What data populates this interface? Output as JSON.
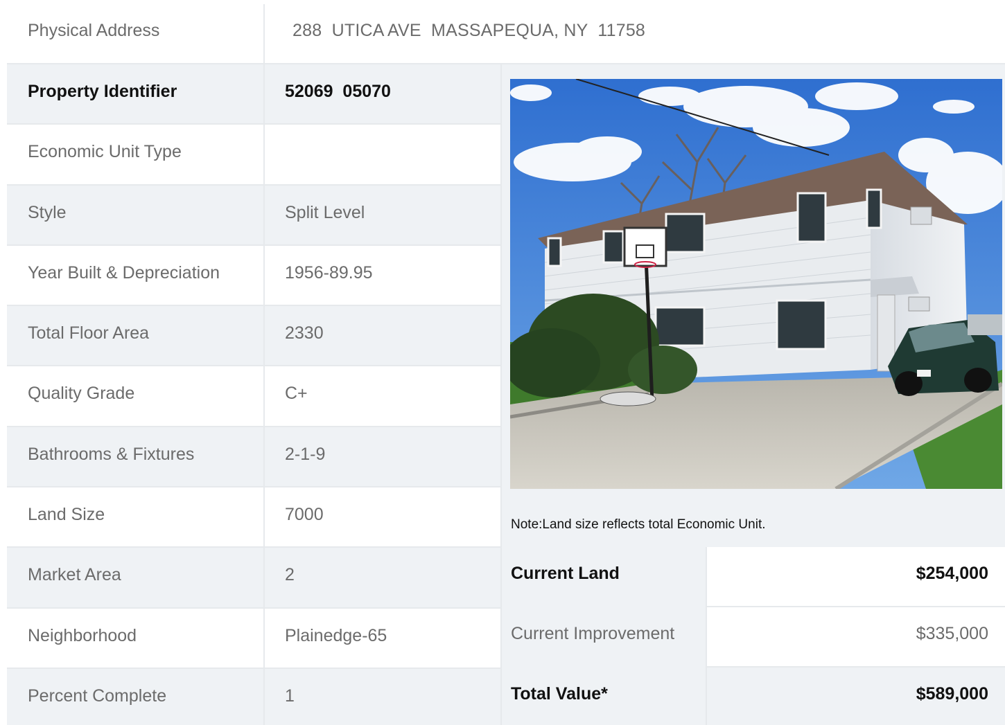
{
  "address": {
    "label": "Physical Address",
    "value": "288  UTICA AVE  MASSAPEQUA, NY  11758"
  },
  "details": [
    {
      "label": "Property Identifier",
      "value": "52069  05070"
    },
    {
      "label": "Economic Unit Type",
      "value": ""
    },
    {
      "label": "Style",
      "value": "Split Level"
    },
    {
      "label": "Year Built & Depreciation",
      "value": "1956-89.95"
    },
    {
      "label": "Total Floor Area",
      "value": "2330"
    },
    {
      "label": "Quality Grade",
      "value": "C+"
    },
    {
      "label": "Bathrooms & Fixtures",
      "value": "2-1-9"
    },
    {
      "label": "Land Size",
      "value": "7000"
    },
    {
      "label": "Market Area",
      "value": "2"
    },
    {
      "label": "Neighborhood",
      "value": "Plainedge-65"
    },
    {
      "label": "Percent Complete",
      "value": "1"
    }
  ],
  "photo": {
    "icon": "house-photo"
  },
  "note": "Note:Land size reflects total Economic Unit.",
  "valuation": [
    {
      "label": "Current Land",
      "value": "$254,000"
    },
    {
      "label": "Current Improvement",
      "value": "$335,000"
    },
    {
      "label": "Total Value*",
      "value": "$589,000"
    }
  ],
  "colors": {
    "row_shade": "#eff2f5",
    "border": "#e6e9ec",
    "text_muted": "#6b6b6b",
    "text_strong": "#111111"
  }
}
